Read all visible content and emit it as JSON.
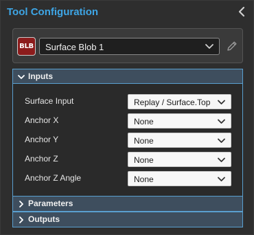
{
  "header": {
    "title": "Tool Configuration"
  },
  "tool": {
    "badge": "BLB",
    "name": "Surface Blob 1"
  },
  "sections": {
    "inputs": "Inputs",
    "parameters": "Parameters",
    "outputs": "Outputs"
  },
  "inputs": {
    "rows": [
      {
        "label": "Surface Input",
        "value": "Replay / Surface.Top"
      },
      {
        "label": "Anchor X",
        "value": "None"
      },
      {
        "label": "Anchor Y",
        "value": "None"
      },
      {
        "label": "Anchor Z",
        "value": "None"
      },
      {
        "label": "Anchor Z Angle",
        "value": "None"
      }
    ]
  },
  "colors": {
    "accent": "#3ea6e6",
    "section_bg": "#3e4e5e",
    "badge_bg": "#8c1c1c"
  }
}
